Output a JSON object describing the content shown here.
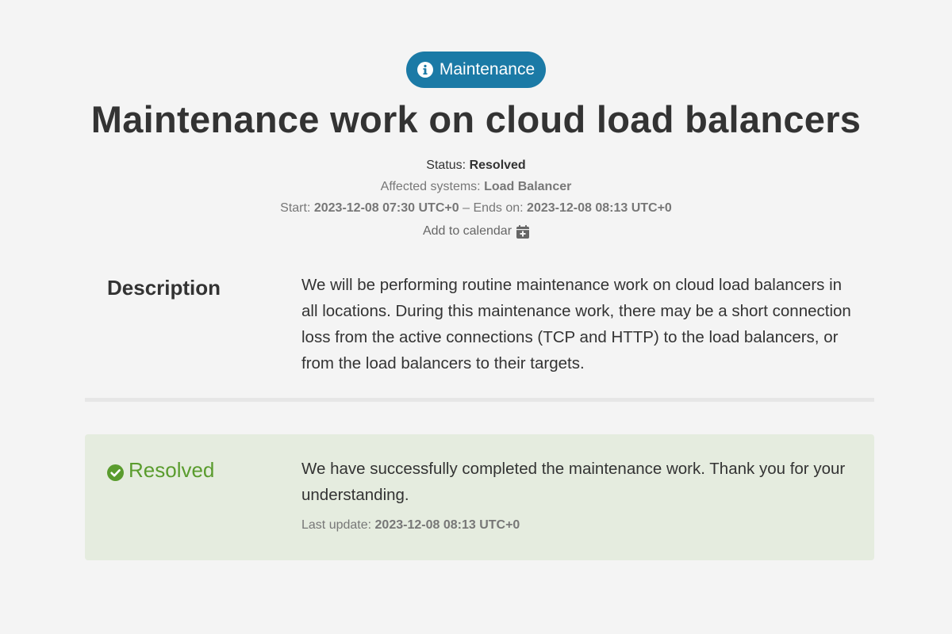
{
  "badge": {
    "label": "Maintenance",
    "color": "#1b7aa6"
  },
  "title": "Maintenance work on cloud load balancers",
  "meta": {
    "status_label": "Status:",
    "status_value": "Resolved",
    "affected_label": "Affected systems:",
    "affected_value": "Load Balancer",
    "start_label": "Start:",
    "start_value": "2023-12-08 07:30 UTC+0",
    "separator": "–",
    "end_label": "Ends on:",
    "end_value": "2023-12-08 08:13 UTC+0",
    "calendar_label": "Add to calendar"
  },
  "description": {
    "label": "Description",
    "text": "We will be performing routine maintenance work on cloud load balancers in all locations. During this maintenance work, there may be a short connection loss from the active connections (TCP and HTTP) to the load balancers, or from the load balancers to their targets."
  },
  "update": {
    "label": "Resolved",
    "color": "#5a9c2e",
    "text": "We have successfully completed the maintenance work. Thank you for your understanding.",
    "last_update_label": "Last update:",
    "last_update_value": "2023-12-08 08:13 UTC+0"
  }
}
